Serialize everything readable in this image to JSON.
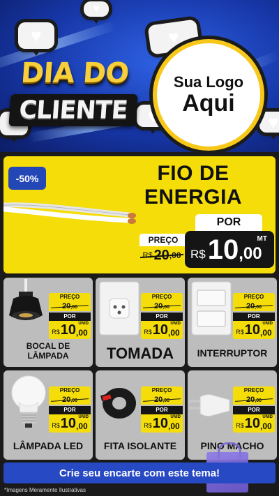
{
  "header": {
    "title_line1": "DIA DO",
    "title_line2": "CLIENTE",
    "logo_line1": "Sua Logo",
    "logo_line2": "Aqui"
  },
  "hero": {
    "discount": "-50%",
    "title_line1": "FIO DE",
    "title_line2": "ENERGIA",
    "preco_label": "PREÇO",
    "old_currency": "R$",
    "old_int": "20",
    "old_dec": ",00",
    "por_label": "POR",
    "new_currency": "R$",
    "new_int": "10",
    "new_dec": ",00",
    "unit": "MT"
  },
  "tag_common": {
    "preco_label": "PREÇO",
    "currency": "R$",
    "old_int": "20",
    "old_dec": ",00",
    "por_label": "POR",
    "new_int": "10",
    "new_dec": ",00",
    "unit": "UNID"
  },
  "products": [
    {
      "label_line1": "BOCAL DE",
      "label_line2": "LÂMPADA",
      "icon": "lamp-socket"
    },
    {
      "label_line1": "TOMADA",
      "label_line2": "",
      "icon": "outlet"
    },
    {
      "label_line1": "INTERRUPTOR",
      "label_line2": "",
      "icon": "switch"
    },
    {
      "label_line1": "LÂMPADA LED",
      "label_line2": "",
      "icon": "led-bulb"
    },
    {
      "label_line1": "FITA ISOLANTE",
      "label_line2": "",
      "icon": "tape-roll"
    },
    {
      "label_line1": "PINO MACHO",
      "label_line2": "",
      "icon": "male-plug"
    }
  ],
  "footer": {
    "cta": "Crie seu encarte com este tema!",
    "disclaimer": "*Imagens Meramente Ilustrativas"
  },
  "colors": {
    "header_blue": "#1737a8",
    "hero_yellow": "#f4dd09",
    "accent_blue": "#2749c4",
    "card_gray": "#bdbdbd",
    "price_dark": "#151515",
    "title_gold": "#f6cf3a"
  }
}
